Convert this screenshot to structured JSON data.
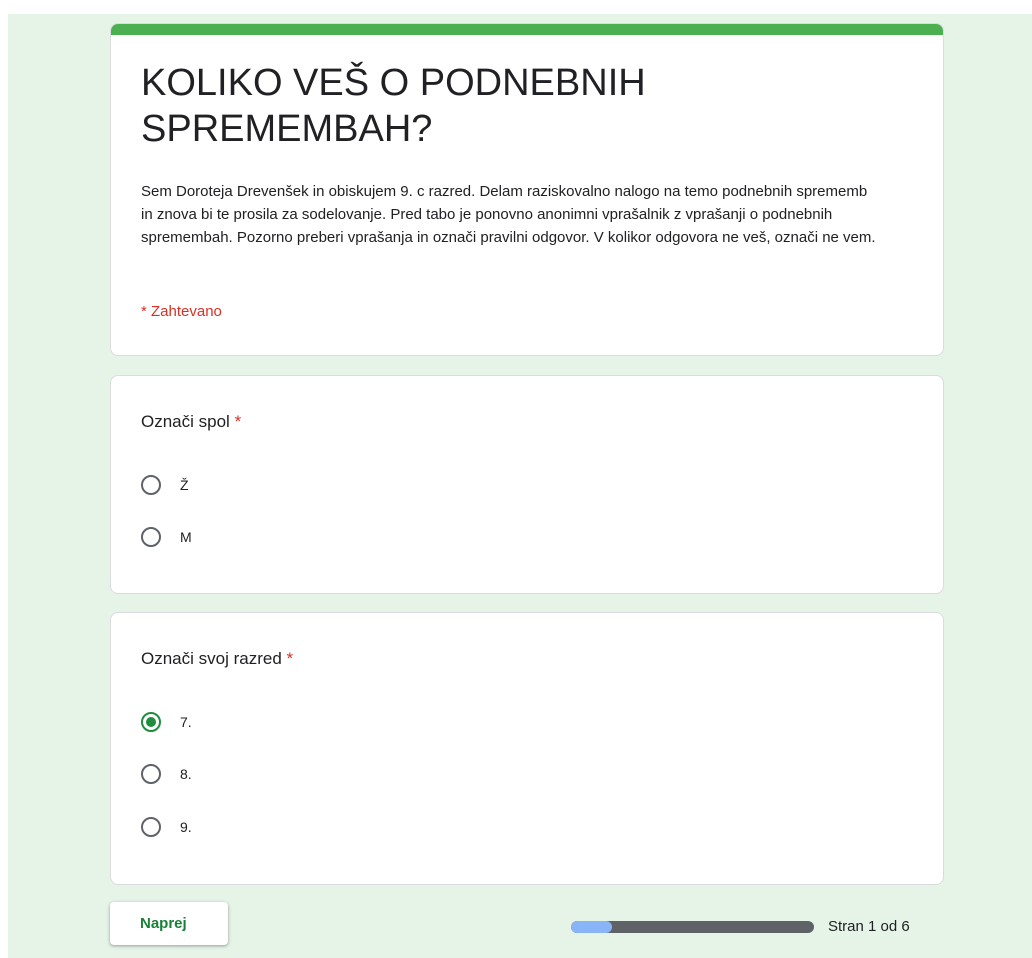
{
  "form": {
    "title": "KOLIKO VEŠ O PODNEBNIH SPREMEMBAH?",
    "description": "Sem Doroteja Drevenšek in obiskujem 9. c razred. Delam raziskovalno nalogo na temo podnebnih sprememb in znova bi te prosila za sodelovanje. Pred tabo je ponovno anonimni vprašalnik z vprašanji o podnebnih spremembah. Pozorno preberi vprašanja in označi pravilni odgovor. V kolikor odgovora ne veš, označi ne vem.",
    "required_note": "* Zahtevano",
    "accent_color": "#4caf50"
  },
  "questions": [
    {
      "title": "Označi spol",
      "required_mark": "*",
      "options": [
        {
          "label": "Ž",
          "selected": false
        },
        {
          "label": "M",
          "selected": false
        }
      ]
    },
    {
      "title": "Označi svoj razred",
      "required_mark": "*",
      "options": [
        {
          "label": "7.",
          "selected": true
        },
        {
          "label": "8.",
          "selected": false
        },
        {
          "label": "9.",
          "selected": false
        }
      ]
    }
  ],
  "footer": {
    "next_label": "Naprej",
    "page_indicator": "Stran 1 od 6",
    "progress_fraction": 0.167,
    "progress_color": "#8ab4f8"
  }
}
